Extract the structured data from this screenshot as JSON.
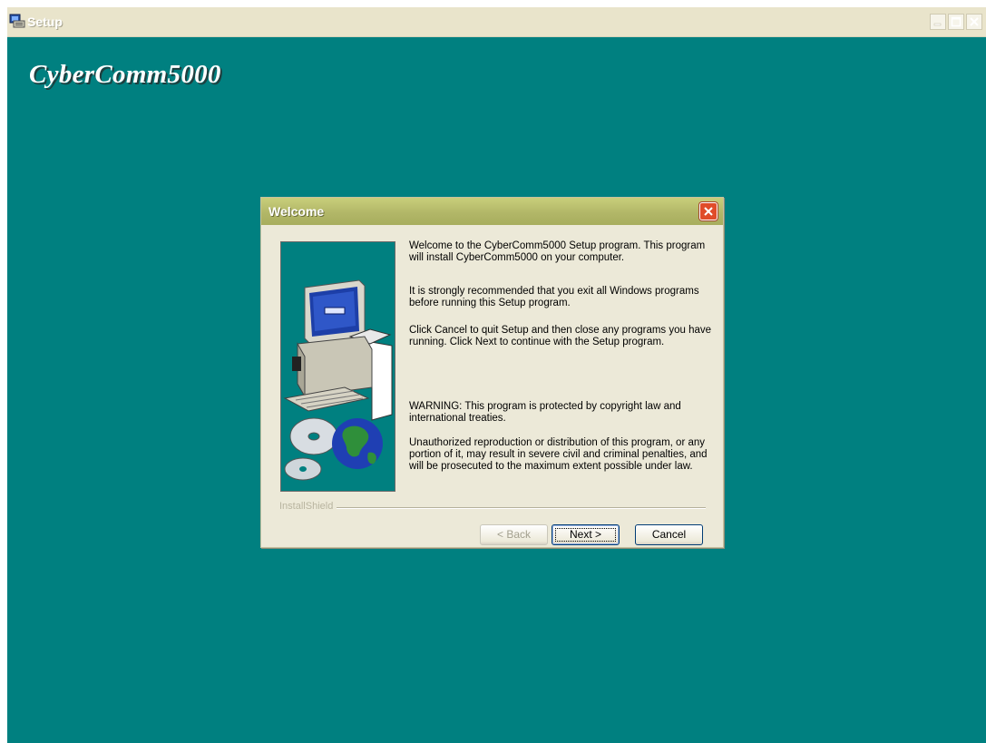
{
  "window": {
    "title": "Setup",
    "brand": "CyberComm5000"
  },
  "dialog": {
    "title": "Welcome",
    "paragraphs": [
      "Welcome to the CyberComm5000 Setup program.  This program will install CyberComm5000 on your computer.",
      "It is strongly recommended that you exit all Windows programs before running this Setup program.",
      "Click Cancel to quit Setup and then close any programs you have running.  Click Next to continue with the Setup program.",
      "WARNING: This program is protected by copyright law and international treaties.",
      "Unauthorized reproduction or distribution of this program, or any portion of it, may result in severe civil and criminal penalties, and will be prosecuted to the maximum extent possible under law."
    ],
    "separator_label": "InstallShield",
    "buttons": {
      "back": "< Back",
      "next": "Next >",
      "cancel": "Cancel"
    }
  },
  "colors": {
    "desktop": "#008080",
    "dialog_face": "#ece9d8",
    "dialog_title": "#b2b768",
    "close_button": "#e04c2a"
  },
  "icons": [
    "setup-app-icon",
    "minimize-icon",
    "maximize-icon",
    "close-icon",
    "computer-illustration",
    "cd-globe-illustration"
  ]
}
